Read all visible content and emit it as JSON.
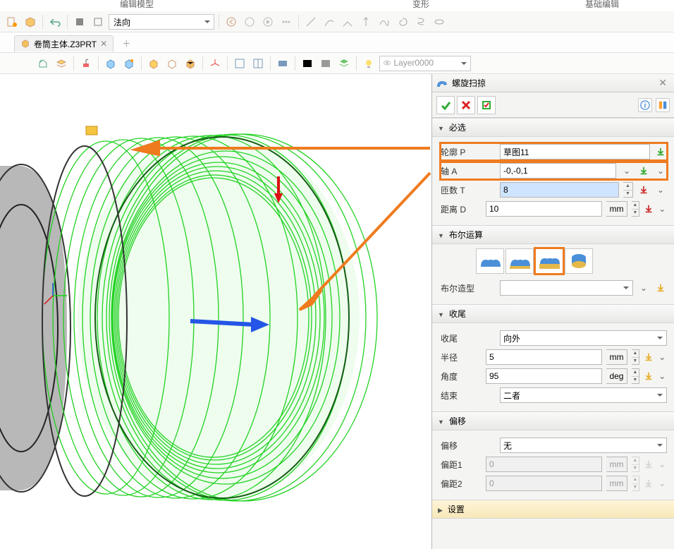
{
  "topmenus": {
    "a": "编辑模型",
    "b": "变形",
    "c": "基础编辑"
  },
  "toolbar1": {
    "mode": "法向"
  },
  "tab": {
    "name": "卷筒主体.Z3PRT"
  },
  "layer": {
    "value": "Layer0000"
  },
  "panel": {
    "title": "螺旋扫掠",
    "section_required": "必选",
    "profile_label": "轮廓 P",
    "profile_value": "草图11",
    "axis_label": "轴 A",
    "axis_value": "-0,-0,1",
    "turns_label": "匝数 T",
    "turns_value": "8",
    "dist_label": "距离 D",
    "dist_value": "10",
    "dist_unit": "mm",
    "section_bool": "布尔运算",
    "bool_shape_label": "布尔造型",
    "section_tail": "收尾",
    "tail_label": "收尾",
    "tail_value": "向外",
    "radius_label": "半径",
    "radius_value": "5",
    "radius_unit": "mm",
    "angle_label": "角度",
    "angle_value": "95",
    "angle_unit": "deg",
    "end_label": "结束",
    "end_value": "二者",
    "section_offset": "偏移",
    "offset_label": "偏移",
    "offset_value": "无",
    "offd1_label": "偏距1",
    "offd1_value": "0",
    "offd1_unit": "mm",
    "offd2_label": "偏距2",
    "offd2_value": "0",
    "offd2_unit": "mm",
    "section_settings": "设置"
  }
}
